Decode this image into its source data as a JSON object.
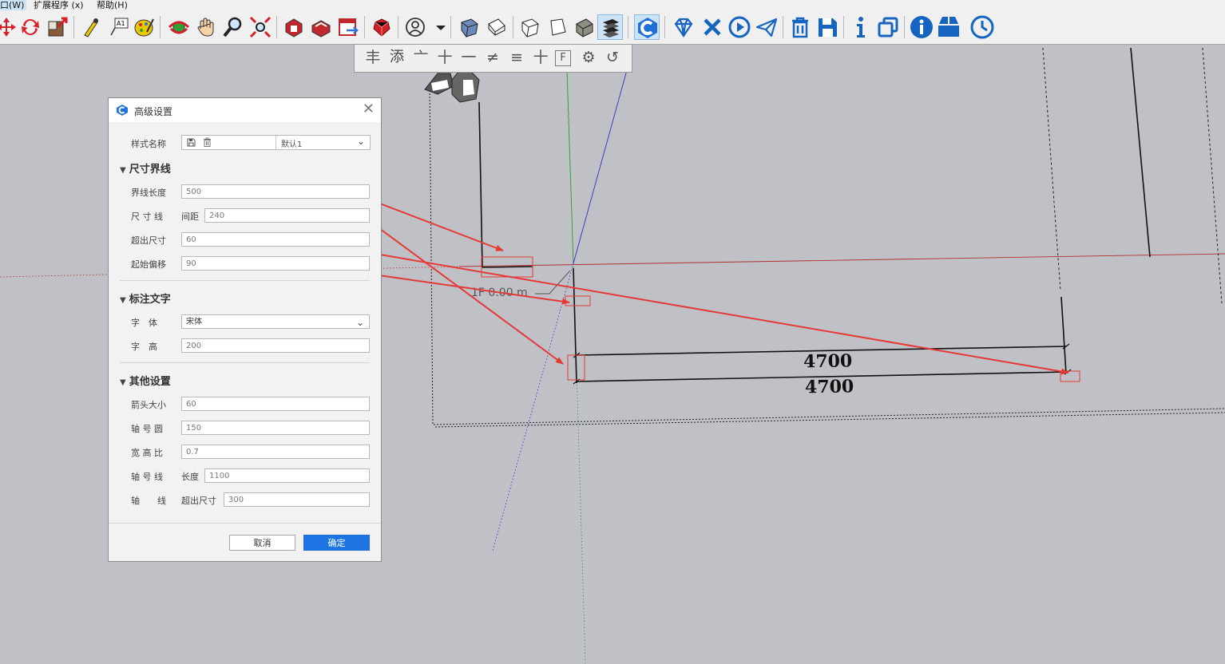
{
  "menu": {
    "window": "口(W)",
    "extensions": "扩展程序 (x)",
    "help": "帮助(H)"
  },
  "toolbar": {
    "icons": [
      "move-icon",
      "rotate-icon",
      "scale-icon",
      "tape-measure-icon",
      "text-label-icon",
      "paint-bucket-icon",
      "orbit-icon",
      "pan-icon",
      "zoom-icon",
      "zoom-extents-icon",
      "warehouse-icon",
      "extension-warehouse-icon",
      "share-model-icon",
      "ruby-console-icon",
      "account-icon",
      "iso-view-icon",
      "top-view-icon",
      "front-view-icon",
      "right-view-icon",
      "back-view-icon",
      "layout-icon",
      "logo-c-icon",
      "diamond-icon",
      "close-x-icon",
      "play-icon",
      "send-icon",
      "trash-icon",
      "save-icon",
      "info-icon",
      "copy-icon",
      "info-circle-icon",
      "window-icon",
      "clock-icon"
    ]
  },
  "subbar": {
    "items": [
      "丰",
      "添",
      "亠",
      "十",
      "一",
      "≠",
      "≡",
      "十",
      "F",
      "⚙",
      "↺"
    ]
  },
  "dialog": {
    "title": "高级设置",
    "close": "✕",
    "style_name_label": "样式名称",
    "style_name_value": "默认1",
    "sec_dim_lines": "尺寸界线",
    "ext_length_label": "界线长度",
    "ext_length_value": "500",
    "dim_line_label": "尺 寸 线",
    "dim_line_sub": "间距",
    "dim_line_value": "240",
    "overshoot_label": "超出尺寸",
    "overshoot_value": "60",
    "start_offset_label": "起始偏移",
    "start_offset_value": "90",
    "sec_text": "标注文字",
    "font_label": "字　体",
    "font_value": "宋体",
    "text_height_label": "字　高",
    "text_height_value": "200",
    "sec_other": "其他设置",
    "arrow_size_label": "箭头大小",
    "arrow_size_value": "60",
    "axis_circle_label": "轴 号 圆",
    "axis_circle_value": "150",
    "aspect_label": "宽 高 比",
    "aspect_value": "0.7",
    "axis_line_label": "轴 号 线",
    "axis_line_sub": "长度",
    "axis_line_value": "1100",
    "axis_label": "轴　　线",
    "axis_sub": "超出尺寸",
    "axis_value": "300",
    "cancel": "取消",
    "ok": "确定"
  },
  "viewport": {
    "level_label": "1F 0.00 m",
    "dim1": "4700",
    "dim2": "4700"
  }
}
